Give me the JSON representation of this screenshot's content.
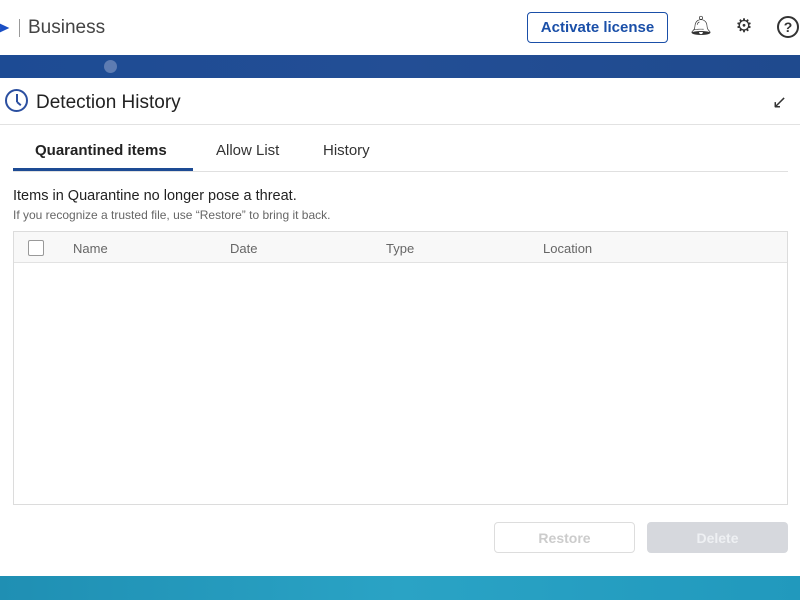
{
  "header": {
    "brand": "Business",
    "activate_label": "Activate license",
    "icons": [
      "bell-icon",
      "gear-icon",
      "help-icon"
    ]
  },
  "panel": {
    "title": "Detection History",
    "tabs": [
      {
        "label": "Quarantined items"
      },
      {
        "label": "Allow List"
      },
      {
        "label": "History"
      }
    ],
    "description": "Items in Quarantine no longer pose a threat.",
    "hint": "If you recognize a trusted file, use “Restore” to bring it back.",
    "columns": [
      "Name",
      "Date",
      "Type",
      "Location"
    ],
    "restore_label": "Restore",
    "delete_label": "Delete"
  },
  "colors": {
    "accent": "#1d4b94"
  }
}
